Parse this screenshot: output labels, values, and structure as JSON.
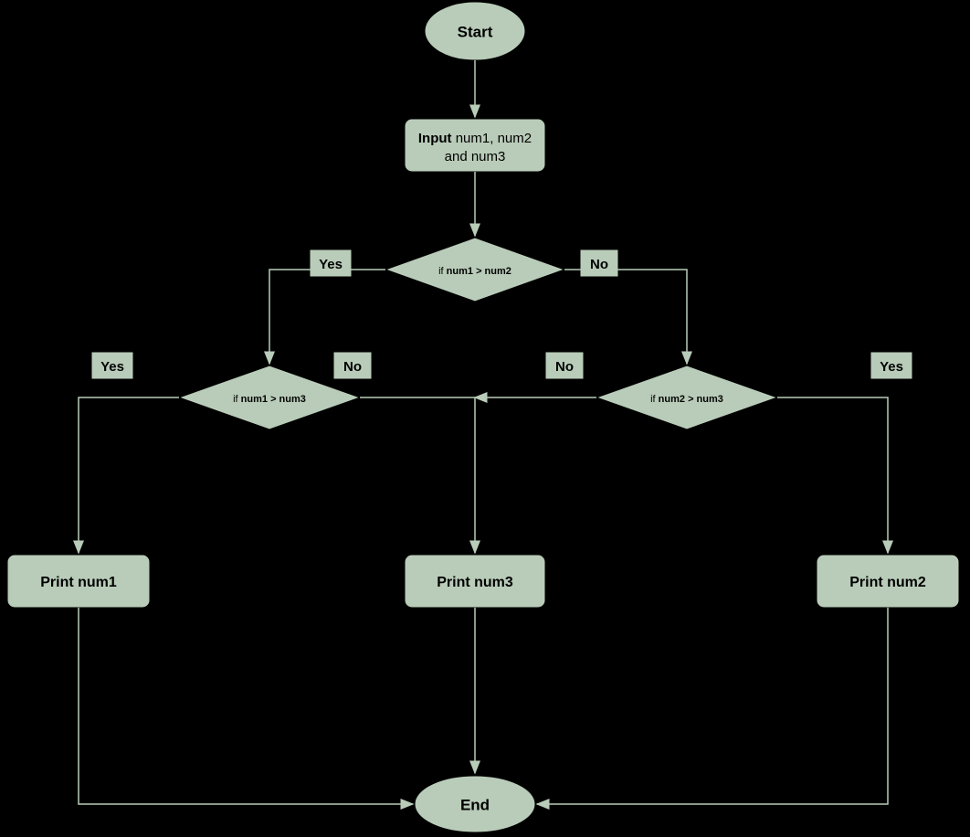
{
  "flowchart": {
    "nodes": {
      "start": "Start",
      "input_bold": "Input",
      "input_line1": " num1, num2",
      "input_line2": "and num3",
      "decision1_prefix": "if ",
      "decision1_cond": "num1 > num2",
      "decision2_prefix": "if ",
      "decision2_cond": "num1 > num3",
      "decision3_prefix": "if ",
      "decision3_cond": "num2 > num3",
      "print1": "Print num1",
      "print2": "Print num2",
      "print3": "Print num3",
      "end": "End"
    },
    "labels": {
      "yes": "Yes",
      "no": "No"
    }
  },
  "colors": {
    "shape_fill": "#b9ccb9",
    "background": "#000000"
  }
}
